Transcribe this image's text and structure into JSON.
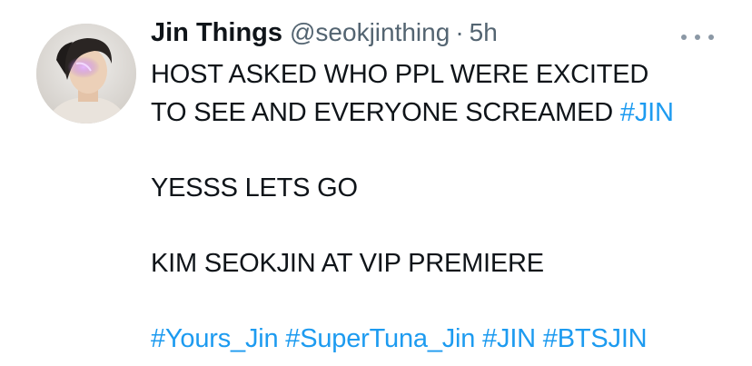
{
  "author": {
    "display_name": "Jin Things",
    "handle": "@seokjinthing",
    "separator": "·",
    "time": "5h",
    "avatar_icon": "profile-photo"
  },
  "menu": {
    "icon": "more-horizontal-icon"
  },
  "text": {
    "line1": "HOST ASKED WHO PPL WERE EXCITED",
    "line2": "TO SEE AND EVERYONE SCREAMED",
    "line2_tag": "#JIN",
    "line3": "YESSS LETS GO",
    "line4": "KIM SEOKJIN AT VIP PREMIERE"
  },
  "hashtags": [
    "#Yours_Jin",
    "#SuperTuna_Jin",
    "#JIN",
    "#BTSJIN"
  ],
  "colors": {
    "link": "#1d9bf0",
    "secondary": "#536471",
    "text": "#0f1419"
  }
}
